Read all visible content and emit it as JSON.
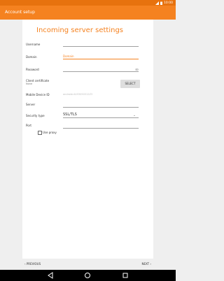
{
  "status_bar": {
    "time": "10:00"
  },
  "app_bar": {
    "title": "Account setup"
  },
  "form": {
    "heading": "Incoming server settings",
    "username": {
      "label": "Username",
      "value": ""
    },
    "domain": {
      "label": "Domain",
      "placeholder": "Domain"
    },
    "password": {
      "label": "Password",
      "value": ""
    },
    "client_certificate": {
      "label": "Client certificate",
      "value": "None",
      "button": "SELECT"
    },
    "mobile_device_id": {
      "label": "Mobile Device ID",
      "value": "androidc4493050312Z3"
    },
    "server": {
      "label": "Server",
      "value": ""
    },
    "security_type": {
      "label": "Security type",
      "value": "SSL/TLS"
    },
    "port": {
      "label": "Port",
      "value": ""
    },
    "use_proxy": {
      "label": "Use proxy",
      "checked": false
    }
  },
  "footer": {
    "previous": "PREVIOUS",
    "next": "NEXT"
  },
  "icons": [
    "signal-icon",
    "battery-icon",
    "show-password-icon",
    "dropdown-arrow-icon",
    "chevron-left-icon",
    "chevron-right-icon",
    "back-icon",
    "home-icon",
    "recents-icon"
  ],
  "colors": {
    "accent": "#f58220",
    "status_bar": "#e7720e",
    "nav_bar": "#000000"
  }
}
